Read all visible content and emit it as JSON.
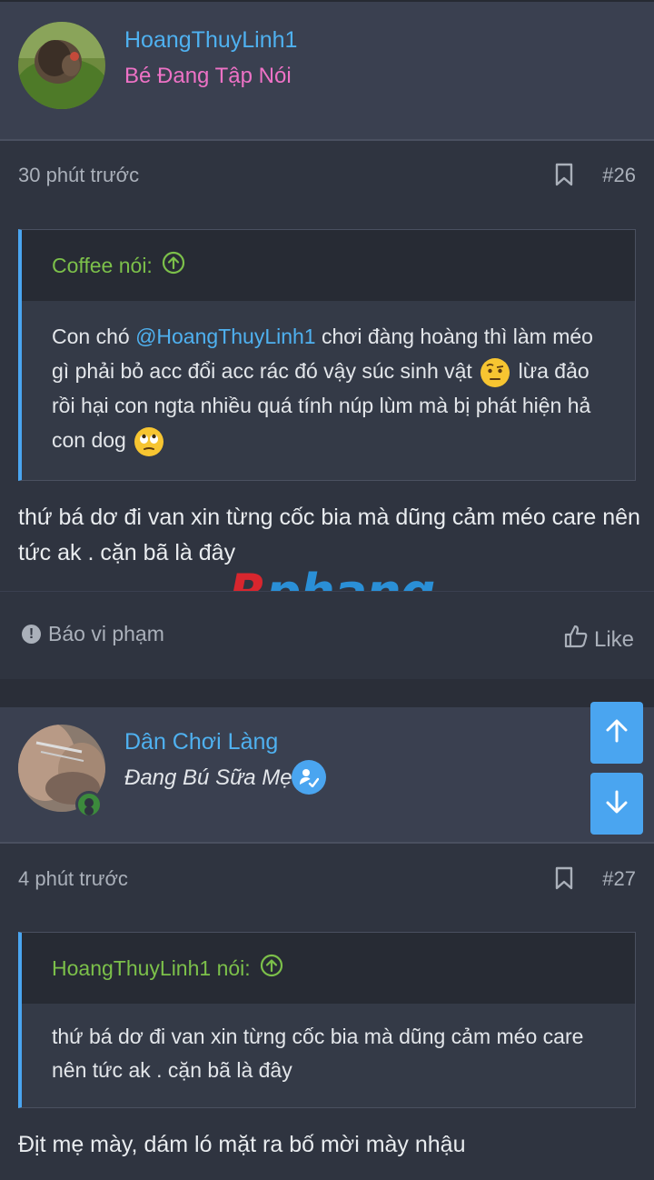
{
  "posts": [
    {
      "username": "HoangThuyLinh1",
      "user_title": "Bé Đang Tập Nói",
      "time": "30 phút trước",
      "post_number": "#26",
      "quote": {
        "author": "Coffee nói:",
        "text_before": "Con chó ",
        "mention": "@HoangThuyLinh1",
        "text_after": " chơi đàng hoàng thì làm méo gì phải bỏ acc đổi acc rác đó vậy súc sinh vật ",
        "text_after_emoji1": " lừa đảo rồi hại con ngta nhiều quá tính núp lùm mà bị phát hiện hả con dog "
      },
      "message": "thứ bá dơ đi van xin từng cốc bia mà dũng cảm méo care nên tức ak . cặn bã là đây",
      "report_label": "Báo vi phạm",
      "like_label": "Like"
    },
    {
      "username": "Dân Chơi Làng",
      "user_title": "Đang Bú Sữa Mẹ",
      "time": "4 phút trước",
      "post_number": "#27",
      "quote": {
        "author": "HoangThuyLinh1 nói:",
        "text": "thứ bá dơ đi van xin từng cốc bia mà dũng cảm méo care nên tức ak . cặn bã là đây"
      },
      "message": "Địt mẹ mày, dám ló mặt ra bố mời mày nhậu"
    }
  ],
  "watermark": {
    "r": "R",
    "rest": "phang"
  },
  "icons": {
    "bookmark": "bookmark-icon",
    "expand_quote": "arrow-up-circle-icon",
    "report": "exclamation-circle-icon",
    "like": "thumbs-up-icon",
    "verified": "verified-user-icon",
    "scroll_up": "arrow-up-icon",
    "scroll_down": "arrow-down-icon"
  },
  "colors": {
    "accent": "#4aa5f0",
    "username": "#4fb1f0",
    "user_title_pink": "#ee72c6",
    "quote_author": "#7cc04a",
    "online": "#3c8a3c"
  }
}
